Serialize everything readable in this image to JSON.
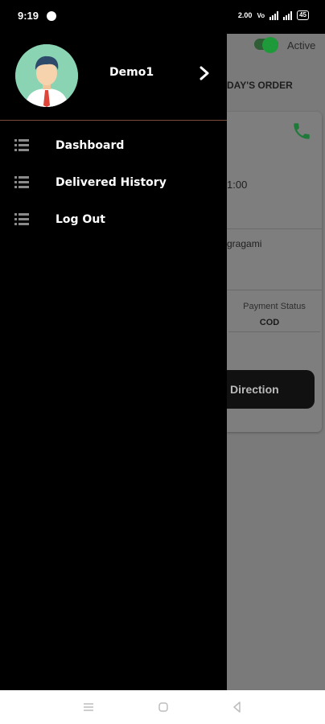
{
  "status_bar": {
    "time": "9:19",
    "data_speed": "2.00",
    "battery": "45"
  },
  "drawer": {
    "user_name": "Demo1",
    "menu": [
      {
        "label": "Dashboard",
        "icon": "list-icon"
      },
      {
        "label": "Delivered History",
        "icon": "list-icon"
      },
      {
        "label": "Log Out",
        "icon": "list-icon"
      }
    ]
  },
  "background": {
    "active_label": "Active",
    "tab_label": "DAY'S ORDER",
    "order": {
      "time_partial": "1:00",
      "name_partial": "gragami",
      "payment_status_label": "Payment Status",
      "payment_status_value": "COD",
      "direction_label": "Direction"
    }
  },
  "colors": {
    "drawer_bg": "#000000",
    "overlay_bg": "#7a7a7a",
    "active_green": "#1f9a3a",
    "phone_green": "#1f7a3a"
  }
}
